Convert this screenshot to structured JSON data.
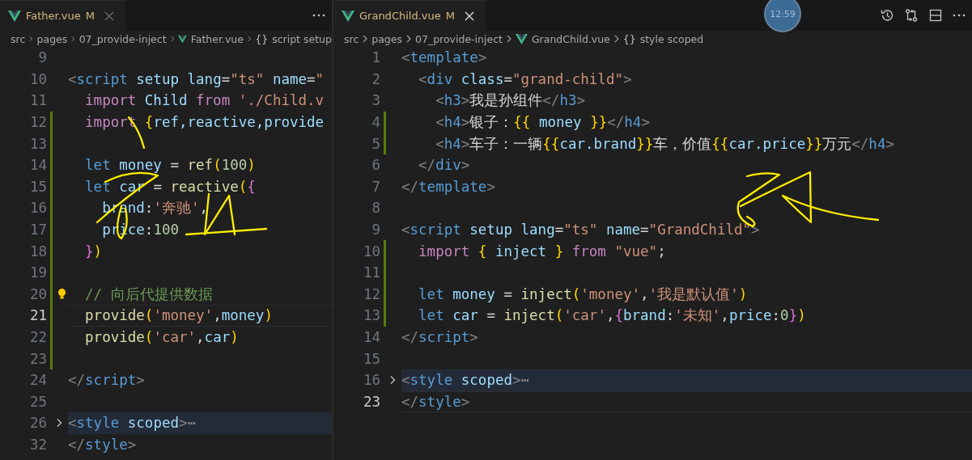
{
  "editors": [
    {
      "tab": {
        "file": "Father.vue",
        "status": "M",
        "focused": false
      },
      "breadcrumb": [
        {
          "kind": "folder",
          "text": "src"
        },
        {
          "kind": "folder",
          "text": "pages"
        },
        {
          "kind": "folder",
          "text": "07_provide-inject"
        },
        {
          "kind": "file",
          "text": "Father.vue"
        },
        {
          "kind": "symbol",
          "glyph": "{}",
          "text": "script setup"
        }
      ],
      "lines": [
        {
          "n": "9",
          "changed": false,
          "current": false,
          "folded": false,
          "lightbulb": false
        },
        {
          "n": "10",
          "changed": false,
          "current": false,
          "folded": false,
          "lightbulb": false,
          "tokens": [
            {
              "kind": "punct",
              "text": "<"
            },
            {
              "kind": "tag",
              "text": "script"
            },
            {
              "kind": "attr",
              "text": " setup"
            },
            {
              "kind": "attr",
              "text": " lang"
            },
            {
              "kind": "plain",
              "text": "="
            },
            {
              "kind": "string",
              "text": "\"ts\""
            },
            {
              "kind": "attr",
              "text": " name"
            },
            {
              "kind": "plain",
              "text": "="
            },
            {
              "kind": "string",
              "text": "\""
            }
          ]
        },
        {
          "n": "11",
          "changed": false,
          "current": false,
          "folded": false,
          "lightbulb": false,
          "tokens": [
            {
              "kind": "keyword",
              "text": "  import"
            },
            {
              "kind": "variable",
              "text": " Child"
            },
            {
              "kind": "keyword",
              "text": " from"
            },
            {
              "kind": "string",
              "text": " './Child.v"
            }
          ]
        },
        {
          "n": "12",
          "changed": true,
          "current": false,
          "folded": false,
          "lightbulb": false,
          "tokens": [
            {
              "kind": "keyword",
              "text": "  import"
            },
            {
              "kind": "bracket1",
              "text": " {"
            },
            {
              "kind": "variable",
              "text": "ref,reactive,provide"
            }
          ]
        },
        {
          "n": "13",
          "changed": true,
          "current": false,
          "folded": false,
          "lightbulb": false
        },
        {
          "n": "14",
          "changed": true,
          "current": false,
          "folded": false,
          "lightbulb": false,
          "tokens": [
            {
              "kind": "storage",
              "text": "  let"
            },
            {
              "kind": "variable",
              "text": " money"
            },
            {
              "kind": "plain",
              "text": " ="
            },
            {
              "kind": "function",
              "text": " ref"
            },
            {
              "kind": "bracket1",
              "text": "("
            },
            {
              "kind": "number",
              "text": "100"
            },
            {
              "kind": "bracket1",
              "text": ")"
            }
          ]
        },
        {
          "n": "15",
          "changed": true,
          "current": false,
          "folded": false,
          "lightbulb": false,
          "tokens": [
            {
              "kind": "storage",
              "text": "  let"
            },
            {
              "kind": "variable",
              "text": " car"
            },
            {
              "kind": "plain",
              "text": " ="
            },
            {
              "kind": "function",
              "text": " reactive"
            },
            {
              "kind": "bracket1",
              "text": "("
            },
            {
              "kind": "bracket2",
              "text": "{"
            }
          ]
        },
        {
          "n": "16",
          "changed": true,
          "current": false,
          "folded": false,
          "lightbulb": false,
          "tokens": [
            {
              "kind": "variable",
              "text": "    brand"
            },
            {
              "kind": "plain",
              "text": ":"
            },
            {
              "kind": "string",
              "text": "'奔驰'"
            },
            {
              "kind": "plain",
              "text": ","
            }
          ]
        },
        {
          "n": "17",
          "changed": true,
          "current": false,
          "folded": false,
          "lightbulb": false,
          "tokens": [
            {
              "kind": "variable",
              "text": "    price"
            },
            {
              "kind": "plain",
              "text": ":"
            },
            {
              "kind": "number",
              "text": "100"
            }
          ]
        },
        {
          "n": "18",
          "changed": true,
          "current": false,
          "folded": false,
          "lightbulb": false,
          "tokens": [
            {
              "kind": "bracket2",
              "text": "  }"
            },
            {
              "kind": "bracket1",
              "text": ")"
            }
          ]
        },
        {
          "n": "19",
          "changed": true,
          "current": false,
          "folded": false,
          "lightbulb": false
        },
        {
          "n": "20",
          "changed": true,
          "current": false,
          "folded": false,
          "lightbulb": true,
          "tokens": [
            {
              "kind": "comment",
              "text": "  // 向后代提供数据"
            }
          ]
        },
        {
          "n": "21",
          "changed": true,
          "current": true,
          "folded": false,
          "lightbulb": false,
          "tokens": [
            {
              "kind": "function",
              "text": "  provide"
            },
            {
              "kind": "bracket1",
              "text": "("
            },
            {
              "kind": "string",
              "text": "'money'"
            },
            {
              "kind": "plain",
              "text": ","
            },
            {
              "kind": "variable",
              "text": "money"
            },
            {
              "kind": "bracket1",
              "text": ")"
            }
          ]
        },
        {
          "n": "22",
          "changed": true,
          "current": false,
          "folded": false,
          "lightbulb": false,
          "tokens": [
            {
              "kind": "function",
              "text": "  provide"
            },
            {
              "kind": "bracket1",
              "text": "("
            },
            {
              "kind": "string",
              "text": "'car'"
            },
            {
              "kind": "plain",
              "text": ","
            },
            {
              "kind": "variable",
              "text": "car"
            },
            {
              "kind": "bracket1",
              "text": ")"
            }
          ]
        },
        {
          "n": "23",
          "changed": true,
          "current": false,
          "folded": false,
          "lightbulb": false
        },
        {
          "n": "24",
          "changed": false,
          "current": false,
          "folded": false,
          "lightbulb": false,
          "tokens": [
            {
              "kind": "punct",
              "text": "</"
            },
            {
              "kind": "tag",
              "text": "script"
            },
            {
              "kind": "punct",
              "text": ">"
            }
          ]
        },
        {
          "n": "25",
          "changed": false,
          "current": false,
          "folded": false,
          "lightbulb": false
        },
        {
          "n": "26",
          "changed": false,
          "current": false,
          "folded": true,
          "lightbulb": false,
          "tokens": [
            {
              "kind": "punct",
              "text": "<"
            },
            {
              "kind": "tag",
              "text": "style"
            },
            {
              "kind": "attr",
              "text": " scoped"
            },
            {
              "kind": "punct",
              "text": ">"
            },
            {
              "kind": "fold",
              "text": "⋯"
            }
          ]
        },
        {
          "n": "32",
          "changed": false,
          "current": false,
          "folded": false,
          "lightbulb": false,
          "tokens": [
            {
              "kind": "punct",
              "text": "</"
            },
            {
              "kind": "tag",
              "text": "style"
            },
            {
              "kind": "punct",
              "text": ">"
            }
          ]
        }
      ]
    },
    {
      "tab": {
        "file": "GrandChild.vue",
        "status": "M",
        "focused": true
      },
      "breadcrumb": [
        {
          "kind": "folder",
          "text": "src"
        },
        {
          "kind": "folder",
          "text": "pages"
        },
        {
          "kind": "folder",
          "text": "07_provide-inject"
        },
        {
          "kind": "file",
          "text": "GrandChild.vue"
        },
        {
          "kind": "symbol",
          "glyph": "{}",
          "text": "style scoped"
        }
      ],
      "lines": [
        {
          "n": "1",
          "changed": false,
          "current": false,
          "folded": false,
          "lightbulb": false,
          "tokens": [
            {
              "kind": "punct",
              "text": "<"
            },
            {
              "kind": "tag",
              "text": "template"
            },
            {
              "kind": "punct",
              "text": ">"
            }
          ]
        },
        {
          "n": "2",
          "changed": false,
          "current": false,
          "folded": false,
          "lightbulb": false,
          "tokens": [
            {
              "kind": "punct",
              "text": "  <"
            },
            {
              "kind": "tag",
              "text": "div"
            },
            {
              "kind": "attr",
              "text": " class"
            },
            {
              "kind": "plain",
              "text": "="
            },
            {
              "kind": "string",
              "text": "\"grand-child\""
            },
            {
              "kind": "punct",
              "text": ">"
            }
          ]
        },
        {
          "n": "3",
          "changed": false,
          "current": false,
          "folded": false,
          "lightbulb": false,
          "tokens": [
            {
              "kind": "punct",
              "text": "    <"
            },
            {
              "kind": "tag",
              "text": "h3"
            },
            {
              "kind": "punct",
              "text": ">"
            },
            {
              "kind": "plain",
              "text": "我是孙组件"
            },
            {
              "kind": "punct",
              "text": "</"
            },
            {
              "kind": "tag",
              "text": "h3"
            },
            {
              "kind": "punct",
              "text": ">"
            }
          ]
        },
        {
          "n": "4",
          "changed": true,
          "current": false,
          "folded": false,
          "lightbulb": false,
          "tokens": [
            {
              "kind": "punct",
              "text": "    <"
            },
            {
              "kind": "tag",
              "text": "h4"
            },
            {
              "kind": "punct",
              "text": ">"
            },
            {
              "kind": "plain",
              "text": "银子："
            },
            {
              "kind": "bracket1",
              "text": "{{"
            },
            {
              "kind": "variable",
              "text": " money "
            },
            {
              "kind": "bracket1",
              "text": "}}"
            },
            {
              "kind": "punct",
              "text": "</"
            },
            {
              "kind": "tag",
              "text": "h4"
            },
            {
              "kind": "punct",
              "text": ">"
            }
          ]
        },
        {
          "n": "5",
          "changed": true,
          "current": false,
          "folded": false,
          "lightbulb": false,
          "tokens": [
            {
              "kind": "punct",
              "text": "    <"
            },
            {
              "kind": "tag",
              "text": "h4"
            },
            {
              "kind": "punct",
              "text": ">"
            },
            {
              "kind": "plain",
              "text": "车子：一辆"
            },
            {
              "kind": "bracket1",
              "text": "{{"
            },
            {
              "kind": "variable",
              "text": "car.brand"
            },
            {
              "kind": "bracket1",
              "text": "}}"
            },
            {
              "kind": "plain",
              "text": "车，价值"
            },
            {
              "kind": "bracket1",
              "text": "{{"
            },
            {
              "kind": "variable",
              "text": "car.price"
            },
            {
              "kind": "bracket1",
              "text": "}}"
            },
            {
              "kind": "plain",
              "text": "万元"
            },
            {
              "kind": "punct",
              "text": "</"
            },
            {
              "kind": "tag",
              "text": "h4"
            },
            {
              "kind": "punct",
              "text": ">"
            }
          ]
        },
        {
          "n": "6",
          "changed": false,
          "current": false,
          "folded": false,
          "lightbulb": false,
          "tokens": [
            {
              "kind": "punct",
              "text": "  </"
            },
            {
              "kind": "tag",
              "text": "div"
            },
            {
              "kind": "punct",
              "text": ">"
            }
          ]
        },
        {
          "n": "7",
          "changed": false,
          "current": false,
          "folded": false,
          "lightbulb": false,
          "tokens": [
            {
              "kind": "punct",
              "text": "</"
            },
            {
              "kind": "tag",
              "text": "template"
            },
            {
              "kind": "punct",
              "text": ">"
            }
          ]
        },
        {
          "n": "8",
          "changed": false,
          "current": false,
          "folded": false,
          "lightbulb": false
        },
        {
          "n": "9",
          "changed": false,
          "current": false,
          "folded": false,
          "lightbulb": false,
          "tokens": [
            {
              "kind": "punct",
              "text": "<"
            },
            {
              "kind": "tag",
              "text": "script"
            },
            {
              "kind": "attr",
              "text": " setup"
            },
            {
              "kind": "attr",
              "text": " lang"
            },
            {
              "kind": "plain",
              "text": "="
            },
            {
              "kind": "string",
              "text": "\"ts\""
            },
            {
              "kind": "attr",
              "text": " name"
            },
            {
              "kind": "plain",
              "text": "="
            },
            {
              "kind": "string",
              "text": "\"GrandChild\""
            },
            {
              "kind": "punct",
              "text": ">"
            }
          ]
        },
        {
          "n": "10",
          "changed": true,
          "current": false,
          "folded": false,
          "lightbulb": false,
          "tokens": [
            {
              "kind": "keyword",
              "text": "  import"
            },
            {
              "kind": "bracket1",
              "text": " {"
            },
            {
              "kind": "variable",
              "text": " inject"
            },
            {
              "kind": "bracket1",
              "text": " }"
            },
            {
              "kind": "keyword",
              "text": " from"
            },
            {
              "kind": "string",
              "text": " \"vue\""
            },
            {
              "kind": "plain",
              "text": ";"
            }
          ]
        },
        {
          "n": "11",
          "changed": true,
          "current": false,
          "folded": false,
          "lightbulb": false
        },
        {
          "n": "12",
          "changed": true,
          "current": false,
          "folded": false,
          "lightbulb": false,
          "tokens": [
            {
              "kind": "storage",
              "text": "  let"
            },
            {
              "kind": "variable",
              "text": " money"
            },
            {
              "kind": "plain",
              "text": " ="
            },
            {
              "kind": "function",
              "text": " inject"
            },
            {
              "kind": "bracket1",
              "text": "("
            },
            {
              "kind": "string",
              "text": "'money'"
            },
            {
              "kind": "plain",
              "text": ","
            },
            {
              "kind": "string",
              "text": "'我是默认值'"
            },
            {
              "kind": "bracket1",
              "text": ")"
            }
          ]
        },
        {
          "n": "13",
          "changed": true,
          "current": false,
          "folded": false,
          "lightbulb": false,
          "tokens": [
            {
              "kind": "storage",
              "text": "  let"
            },
            {
              "kind": "variable",
              "text": " car"
            },
            {
              "kind": "plain",
              "text": " ="
            },
            {
              "kind": "function",
              "text": " inject"
            },
            {
              "kind": "bracket1",
              "text": "("
            },
            {
              "kind": "string",
              "text": "'car'"
            },
            {
              "kind": "plain",
              "text": ","
            },
            {
              "kind": "bracket2",
              "text": "{"
            },
            {
              "kind": "variable",
              "text": "brand"
            },
            {
              "kind": "plain",
              "text": ":"
            },
            {
              "kind": "string",
              "text": "'未知'"
            },
            {
              "kind": "plain",
              "text": ","
            },
            {
              "kind": "variable",
              "text": "price"
            },
            {
              "kind": "plain",
              "text": ":"
            },
            {
              "kind": "number",
              "text": "0"
            },
            {
              "kind": "bracket2",
              "text": "}"
            },
            {
              "kind": "bracket1",
              "text": ")"
            }
          ]
        },
        {
          "n": "14",
          "changed": false,
          "current": false,
          "folded": false,
          "lightbulb": false,
          "tokens": [
            {
              "kind": "punct",
              "text": "</"
            },
            {
              "kind": "tag",
              "text": "script"
            },
            {
              "kind": "punct",
              "text": ">"
            }
          ]
        },
        {
          "n": "15",
          "changed": false,
          "current": false,
          "folded": false,
          "lightbulb": false
        },
        {
          "n": "16",
          "changed": false,
          "current": false,
          "folded": true,
          "lightbulb": false,
          "tokens": [
            {
              "kind": "punct",
              "text": "<"
            },
            {
              "kind": "tag",
              "text": "style"
            },
            {
              "kind": "attr",
              "text": " scoped"
            },
            {
              "kind": "punct",
              "text": ">"
            },
            {
              "kind": "fold",
              "text": "⋯"
            }
          ]
        },
        {
          "n": "23",
          "changed": false,
          "current": true,
          "folded": false,
          "lightbulb": false,
          "tokens": [
            {
              "kind": "punct",
              "text": "</"
            },
            {
              "kind": "tag",
              "text": "style"
            },
            {
              "kind": "punct",
              "text": ">"
            }
          ]
        }
      ]
    }
  ],
  "timestamp_badge": {
    "text": "12:59"
  }
}
